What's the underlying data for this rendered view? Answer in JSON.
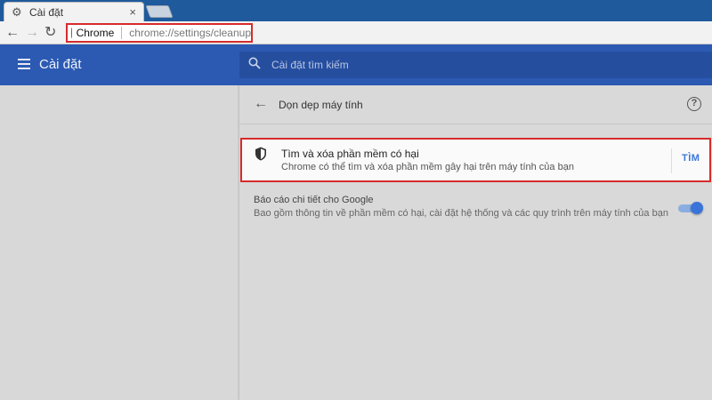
{
  "browser": {
    "tab_title": "Cài đặt",
    "tab_close": "×",
    "omnibox_origin": "Chrome",
    "omnibox_url": "chrome://settings/cleanup"
  },
  "header": {
    "title": "Cài đặt",
    "search_placeholder": "Cài đặt tìm kiếm"
  },
  "page": {
    "title": "Dọn dẹp máy tính",
    "help_label": "?"
  },
  "cleanup": {
    "title": "Tìm và xóa phần mềm có hại",
    "subtitle": "Chrome có thể tìm và xóa phần mềm gây hại trên máy tính của bạn",
    "action_label": "TÌM"
  },
  "report": {
    "title": "Báo cáo chi tiết cho Google",
    "subtitle": "Bao gồm thông tin về phần mềm có hại, cài đặt hệ thống và các quy trình trên máy tính của bạn",
    "toggle_on": true
  },
  "colors": {
    "accent": "#2c5ab3",
    "highlight_border": "#d62b2b",
    "link": "#3c78d8"
  },
  "icons": [
    "gear-icon",
    "close-icon",
    "back-icon",
    "forward-icon",
    "reload-icon",
    "secure-icon",
    "menu-icon",
    "search-icon",
    "back-arrow-icon",
    "help-icon",
    "shield-icon"
  ]
}
